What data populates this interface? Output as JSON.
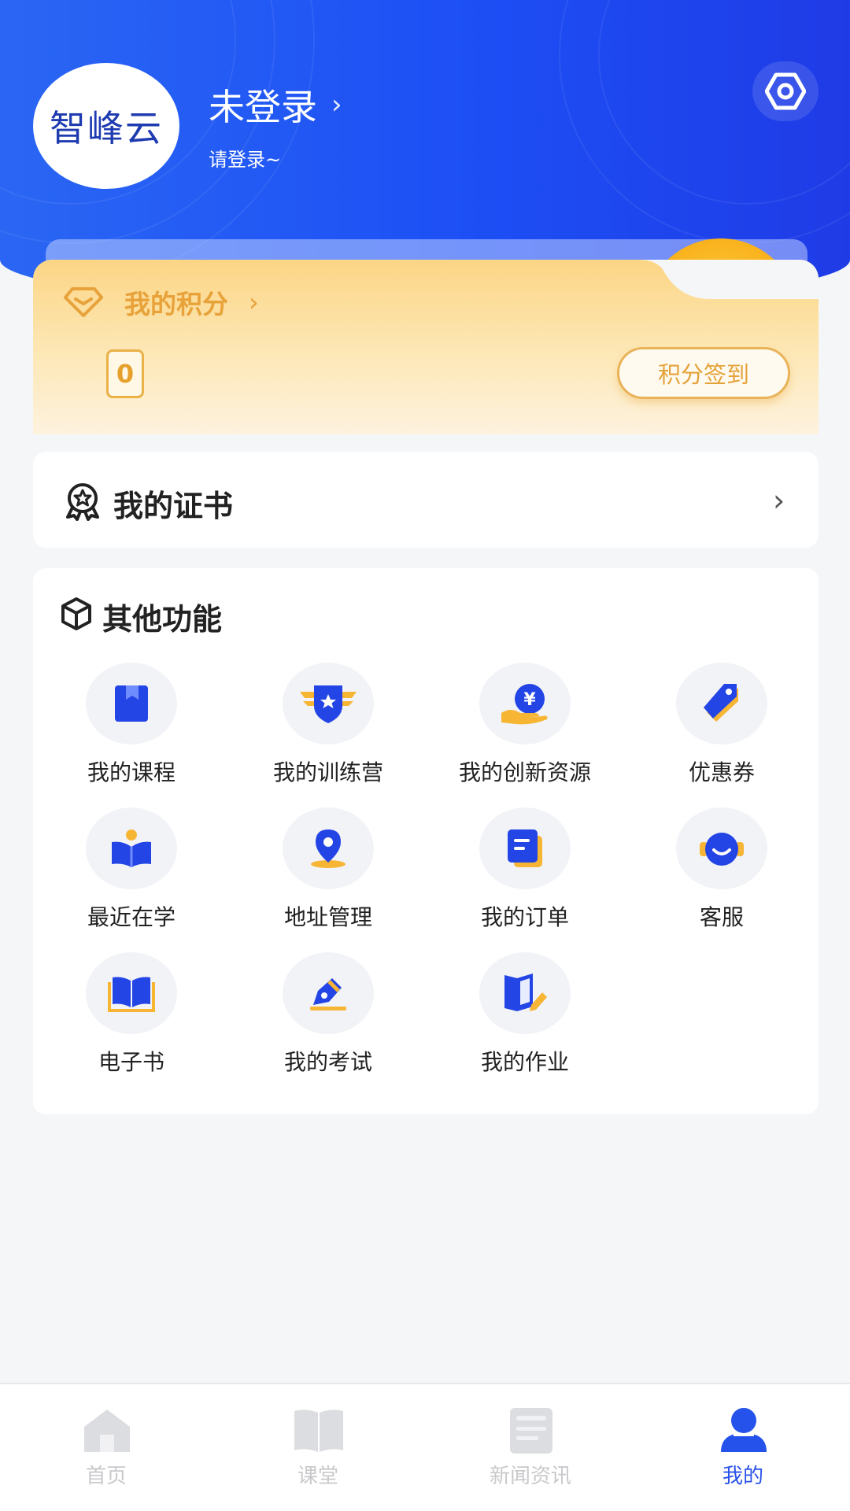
{
  "header": {
    "avatar_text": "智峰云",
    "login_title": "未登录",
    "login_subtitle": "请登录~",
    "settings_icon": "settings-hex-icon"
  },
  "points": {
    "title": "我的积分",
    "value": "0",
    "checkin_label": "积分签到"
  },
  "certificate": {
    "label": "我的证书"
  },
  "functions": {
    "title": "其他功能",
    "items": [
      {
        "label": "我的课程",
        "icon": "course-book-icon"
      },
      {
        "label": "我的训练营",
        "icon": "training-camp-badge-icon"
      },
      {
        "label": "我的创新资源",
        "icon": "innovation-resource-icon"
      },
      {
        "label": "优惠券",
        "icon": "coupon-tag-icon"
      },
      {
        "label": "最近在学",
        "icon": "recent-study-icon"
      },
      {
        "label": "地址管理",
        "icon": "address-pin-icon"
      },
      {
        "label": "我的订单",
        "icon": "order-doc-icon"
      },
      {
        "label": "客服",
        "icon": "customer-service-icon"
      },
      {
        "label": "电子书",
        "icon": "ebook-icon"
      },
      {
        "label": "我的考试",
        "icon": "exam-pen-icon"
      },
      {
        "label": "我的作业",
        "icon": "homework-icon"
      }
    ]
  },
  "tabbar": {
    "tabs": [
      {
        "label": "首页",
        "icon": "home-icon",
        "active": false
      },
      {
        "label": "课堂",
        "icon": "classroom-book-icon",
        "active": false
      },
      {
        "label": "新闻资讯",
        "icon": "news-icon",
        "active": false
      },
      {
        "label": "我的",
        "icon": "profile-icon",
        "active": true
      }
    ]
  },
  "colors": {
    "brand_blue": "#1d4ff5",
    "points_gold": "#e8a23a",
    "active_tab": "#2a52e8",
    "inactive_tab": "#c9c9cc"
  }
}
